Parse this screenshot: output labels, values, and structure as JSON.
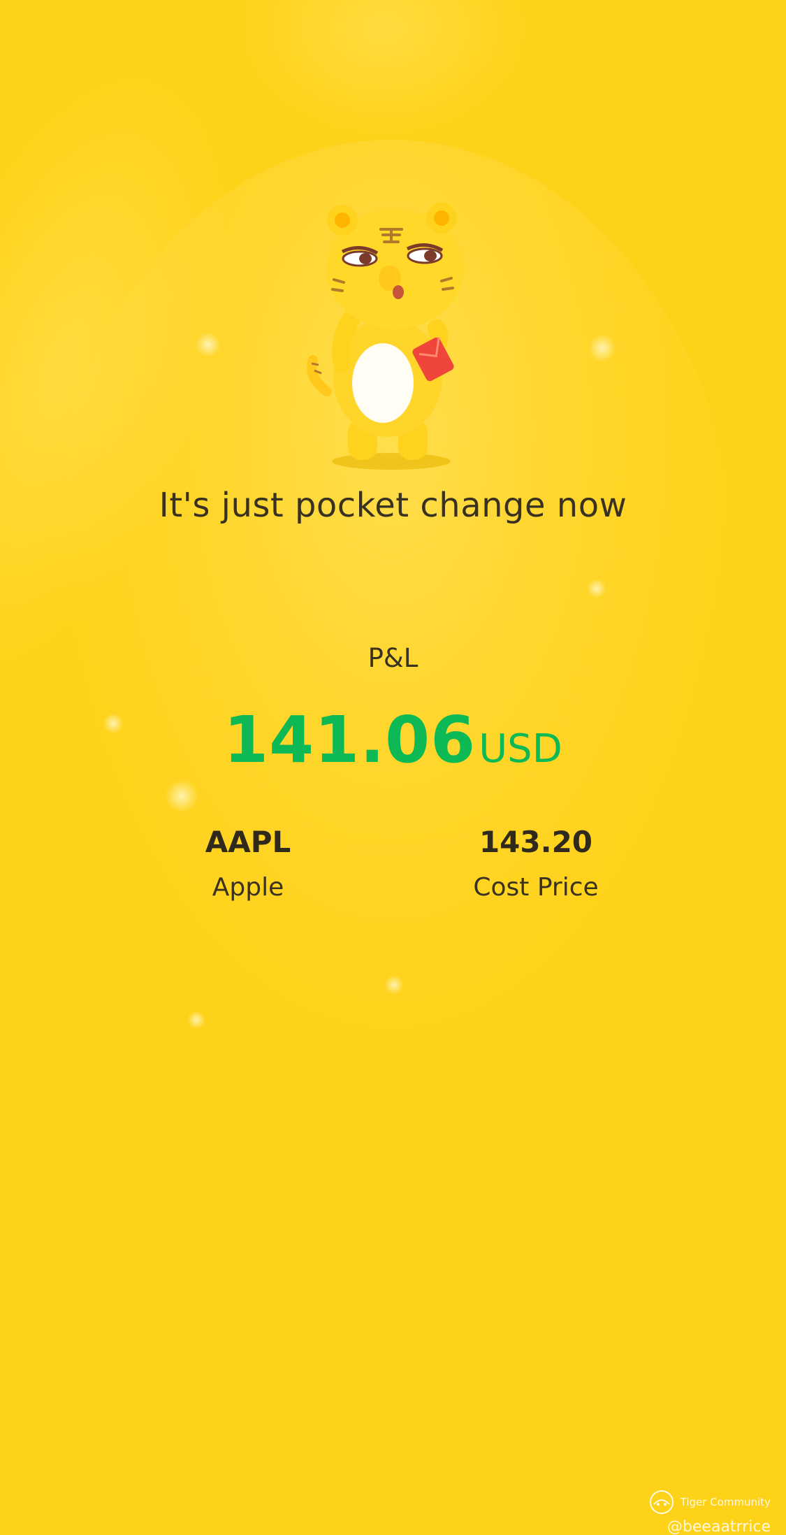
{
  "headline": "It's just pocket change now",
  "pnl": {
    "label": "P&L",
    "value": "141.06",
    "currency": "USD",
    "color": "#0DB955"
  },
  "stock": {
    "ticker": "AAPL",
    "name": "Apple"
  },
  "cost": {
    "value": "143.20",
    "label": "Cost Price"
  },
  "mascot": {
    "icon": "tiger-mascot-with-red-envelope-icon"
  },
  "watermark": {
    "logo_icon": "tiger-logo-icon",
    "brand": "Tiger Community",
    "handle": "@beeaatrrice"
  },
  "colors": {
    "background": "#FFD21A",
    "text": "#3a3220"
  }
}
